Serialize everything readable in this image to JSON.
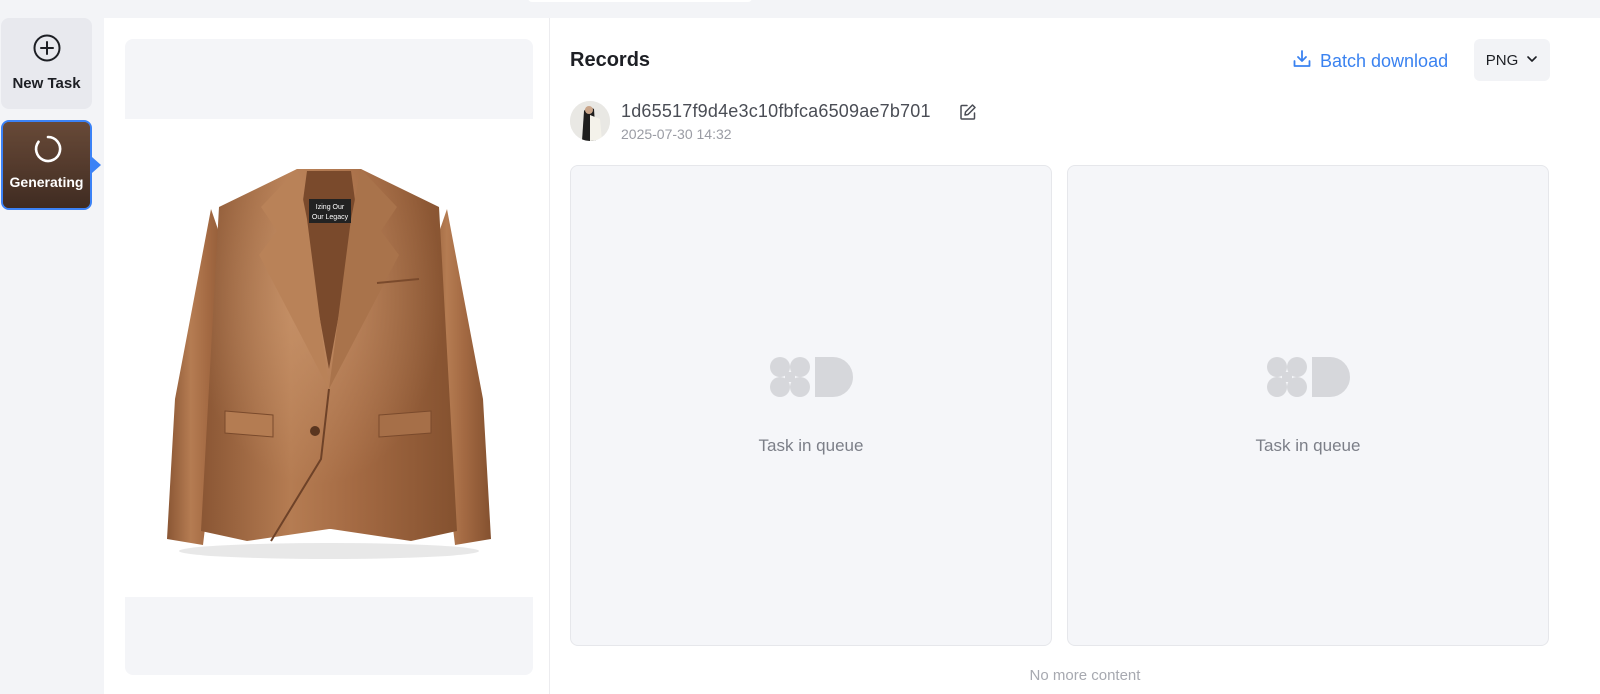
{
  "rail": {
    "new_task_label": "New Task",
    "active_task_label": "Generating"
  },
  "records": {
    "title": "Records",
    "batch_download_label": "Batch download",
    "format": "PNG",
    "record_id": "1d65517f9d4e3c10fbfca6509ae7b701",
    "record_date": "2025-07-30 14:32",
    "cards": [
      {
        "status": "Task in queue"
      },
      {
        "status": "Task in queue"
      }
    ],
    "footer": "No more content"
  },
  "preview": {
    "tag_line1": "Izing Our",
    "tag_line2": "Our Legacy"
  },
  "colors": {
    "accent": "#3b82f6",
    "link": "#3a82f0",
    "jacket": "#a06a44"
  }
}
